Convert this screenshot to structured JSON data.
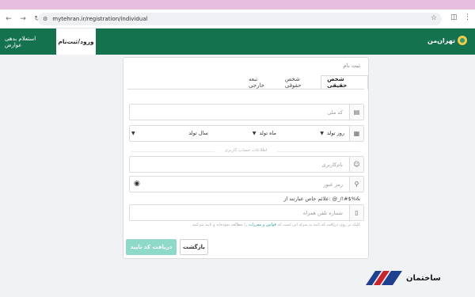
{
  "browser": {
    "url": "mytehran.ir/registration/individual",
    "back_icon": "arrow-left-icon",
    "forward_icon": "arrow-right-icon",
    "reload_icon": "reload-icon"
  },
  "header": {
    "login_tab": "ورود/ثبت‌نام",
    "debt_tab": "استعلام بدهی عوارض",
    "logo_text": "تهران‌من",
    "brand_color": "#15724f"
  },
  "form": {
    "title": "ثبت نام",
    "tabs": [
      {
        "label": "شخص حقیقی",
        "active": true
      },
      {
        "label": "شخص حقوقی",
        "active": false
      },
      {
        "label": "تبعه خارجی",
        "active": false
      }
    ],
    "national_code_placeholder": "کد ملی",
    "birth_day": "روز تولد",
    "birth_month": "ماه تولد",
    "birth_year": "سال تولد",
    "account_info_label": "اطلاعات حساب کاربری",
    "username_placeholder": "نام‌کاربری",
    "password_placeholder": "رمز عبور",
    "password_hint": "علائم خاص عبارتند از: @_/!#$%&",
    "phone_placeholder": "شماره تلفن همراه",
    "note_prefix": "کلیک بر روی دریافت کد تایید به منزله این است که",
    "note_link": "قوانین و مقررات",
    "note_suffix": "را مطالعه نموده‌اید و تایید می‌کنید",
    "submit_label": "دریافت کد تایید",
    "back_label": "بازگشت",
    "submit_color": "#8fd9c9"
  },
  "watermark": {
    "text": "ساختمان"
  }
}
